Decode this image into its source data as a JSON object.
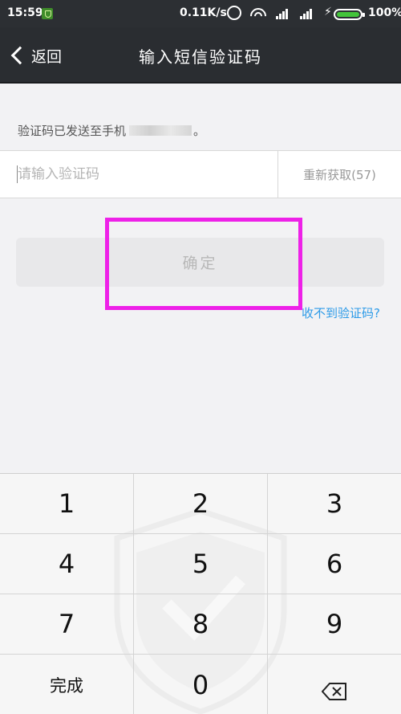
{
  "status_bar": {
    "time": "15:59",
    "network_speed": "0.11K/s",
    "battery_percent": "100%",
    "icons": [
      "security-shield-icon",
      "alarm-icon",
      "wifi-icon",
      "signal-icon",
      "signal-icon",
      "charging-icon",
      "battery-icon"
    ]
  },
  "nav": {
    "back_label": "返回",
    "title": "输入短信验证码"
  },
  "form": {
    "hint_prefix": "验证码已发送至手机",
    "hint_suffix": "。",
    "code_value": "",
    "code_placeholder": "请输入验证码",
    "resend_label": "重新获取(57)",
    "confirm_label": "确定",
    "no_code_link": "收不到验证码?"
  },
  "keypad": {
    "keys": [
      "1",
      "2",
      "3",
      "4",
      "5",
      "6",
      "7",
      "8",
      "9",
      "完成",
      "0",
      "⌫"
    ],
    "done_label": "完成",
    "delete_icon": "backspace-icon",
    "watermark_icon": "shield-check-icon"
  },
  "colors": {
    "navbar": "#2a2d31",
    "highlight": "#ee21e8",
    "link": "#2d9be8",
    "battery": "#43c43a"
  }
}
